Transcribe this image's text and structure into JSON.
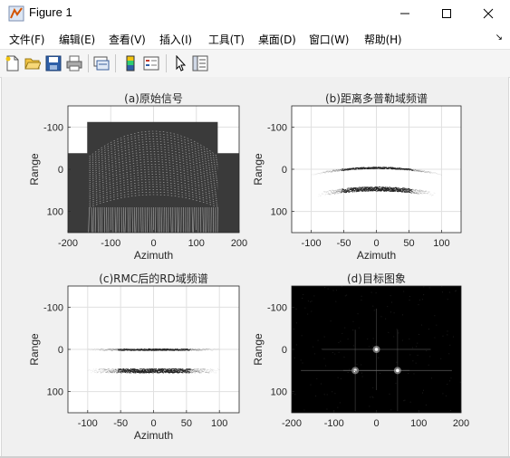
{
  "window": {
    "title": "Figure 1",
    "icon": "matlab-figure-icon",
    "controls": [
      "minimize-icon",
      "maximize-icon",
      "close-icon"
    ]
  },
  "menu": [
    "文件(F)",
    "编辑(E)",
    "查看(V)",
    "插入(I)",
    "工具(T)",
    "桌面(D)",
    "窗口(W)",
    "帮助(H)"
  ],
  "menu_overflow": "↘",
  "toolbar": [
    "new-figure-icon",
    "open-file-icon",
    "save-icon",
    "print-icon",
    "link-plot-icon",
    "insert-colorbar-icon",
    "insert-legend-icon",
    "pointer-icon",
    "property-inspector-icon"
  ],
  "colors": {
    "axes_bg": "#ffffff",
    "window_bg": "#f0f0f0",
    "grid": "#e0e0e0",
    "image_bg_d": "#000000"
  },
  "chart_data": [
    {
      "type": "heatmap",
      "title": "(a)原始信号",
      "xlabel": "Azimuth",
      "ylabel": "Range",
      "xlim": [
        -200,
        200
      ],
      "ylim": [
        -150,
        150
      ],
      "y_reversed": true,
      "xticks": [
        -200,
        -100,
        0,
        100,
        200
      ],
      "yticks": [
        -100,
        0,
        100
      ],
      "grid": true,
      "colormap": "gray"
    },
    {
      "type": "heatmap",
      "title": "(b)距离多普勒域频谱",
      "xlabel": "Azimuth",
      "ylabel": "Range",
      "xlim": [
        -130,
        130
      ],
      "ylim": [
        -150,
        150
      ],
      "y_reversed": true,
      "xticks": [
        -100,
        -50,
        0,
        50,
        100
      ],
      "yticks": [
        -100,
        0,
        100
      ],
      "grid": true,
      "colormap": "gray",
      "bands": [
        {
          "range": 0,
          "curved": true,
          "azimuth_extent": [
            -100,
            100
          ]
        },
        {
          "range": 50,
          "curved": true,
          "azimuth_extent": [
            -90,
            90
          ]
        }
      ]
    },
    {
      "type": "heatmap",
      "title": "(c)RMC后的RD域频谱",
      "xlabel": "Azimuth",
      "ylabel": "Range",
      "xlim": [
        -130,
        130
      ],
      "ylim": [
        -150,
        150
      ],
      "y_reversed": true,
      "xticks": [
        -100,
        -50,
        0,
        50,
        100
      ],
      "yticks": [
        -100,
        0,
        100
      ],
      "grid": true,
      "colormap": "gray",
      "bands": [
        {
          "range": 0,
          "curved": false,
          "azimuth_extent": [
            -100,
            100
          ]
        },
        {
          "range": 50,
          "curved": false,
          "azimuth_extent": [
            -100,
            100
          ]
        }
      ]
    },
    {
      "type": "heatmap",
      "title": "(d)目标图象",
      "xlabel": "",
      "ylabel": "Range",
      "xlim": [
        -200,
        200
      ],
      "ylim": [
        -150,
        150
      ],
      "y_reversed": true,
      "xticks": [
        -200,
        -100,
        0,
        100,
        200
      ],
      "yticks": [
        -100,
        0,
        100
      ],
      "grid": false,
      "colormap": "gray",
      "targets": [
        {
          "azimuth": 0,
          "range": 0
        },
        {
          "azimuth": -50,
          "range": 50
        },
        {
          "azimuth": 50,
          "range": 50
        }
      ]
    }
  ]
}
